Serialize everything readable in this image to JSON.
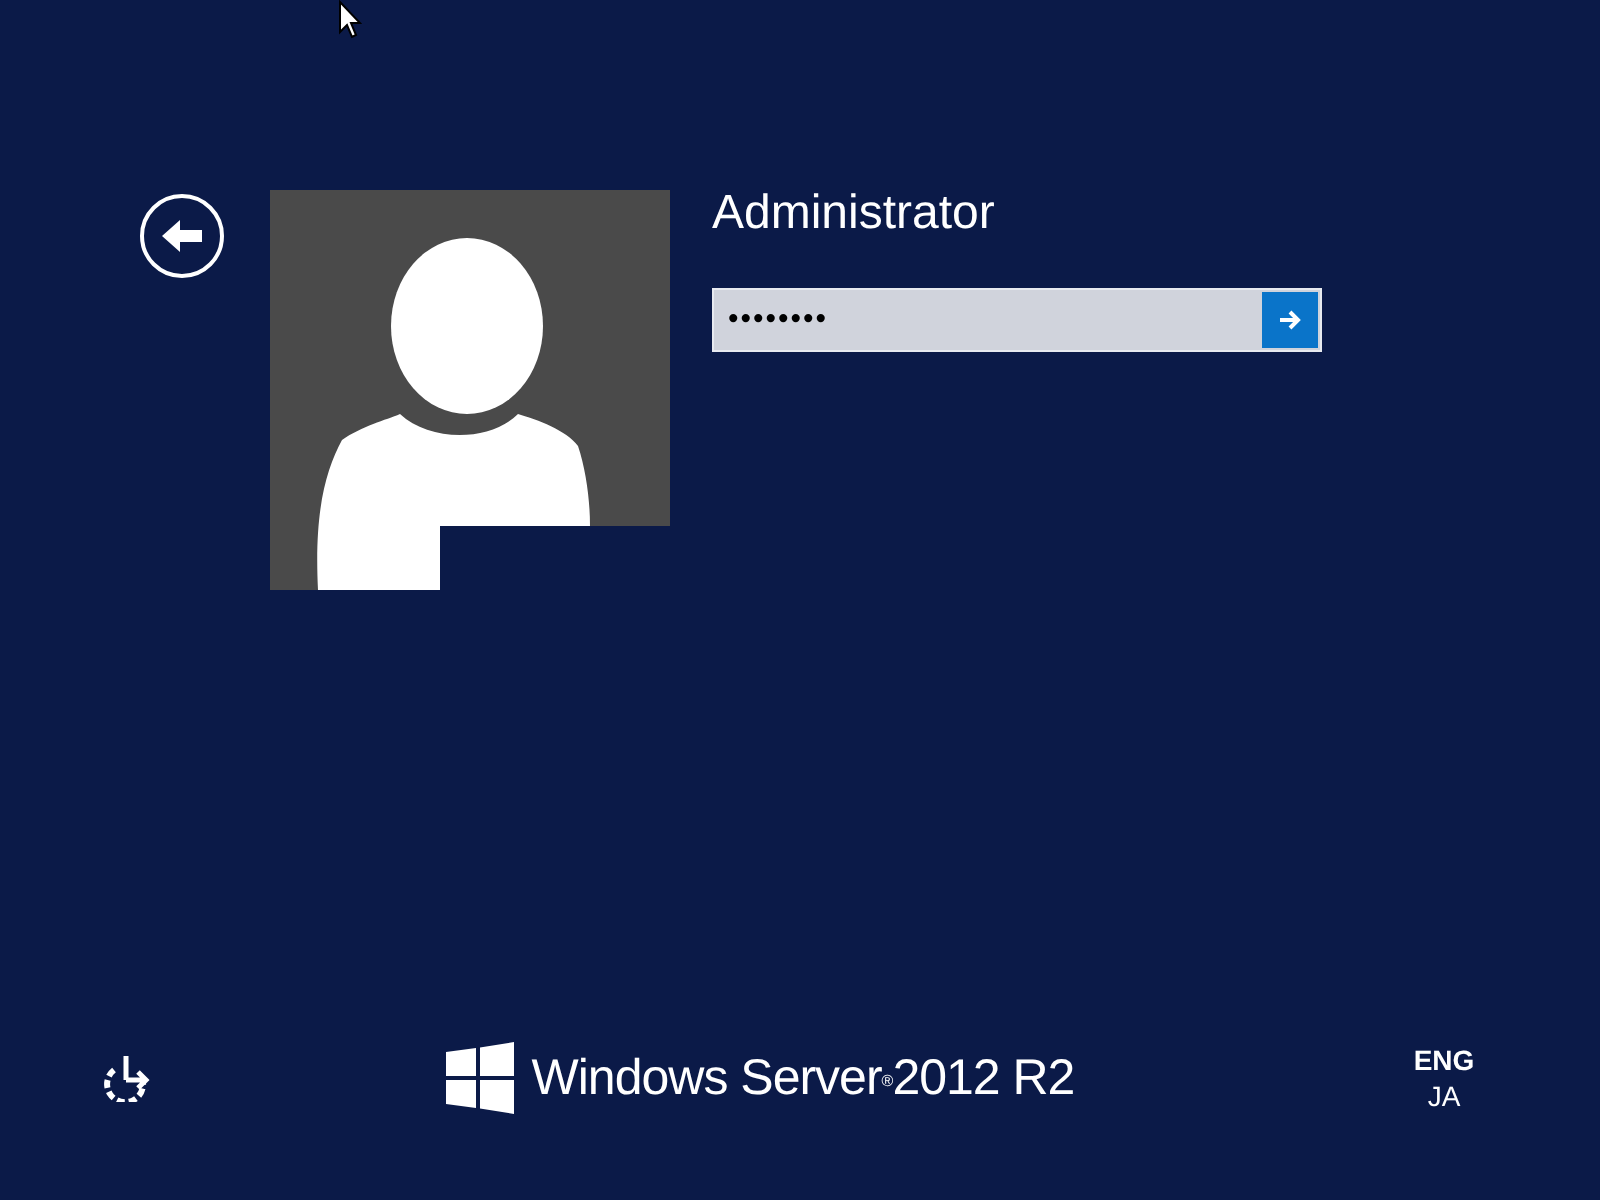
{
  "user": {
    "name": "Administrator"
  },
  "password": {
    "value": "••••••••"
  },
  "branding": {
    "product": "Windows Server$^{®}$2012 R2"
  },
  "language": {
    "primary": "ENG",
    "secondary": "JA"
  }
}
